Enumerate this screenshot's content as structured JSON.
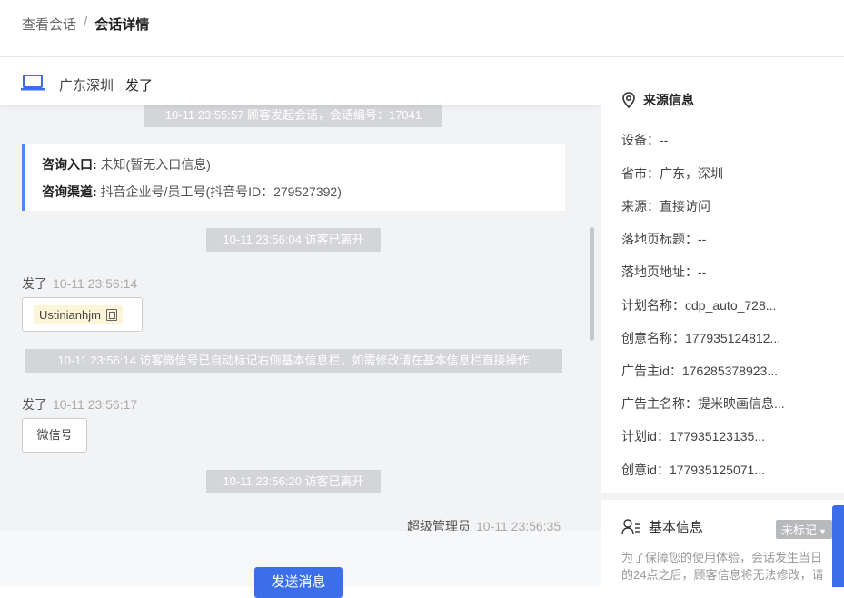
{
  "breadcrumb": {
    "parent": "查看会话",
    "separator": "/",
    "current": "会话详情"
  },
  "chat_header": {
    "location": "广东深圳",
    "visitor_name": "发了"
  },
  "messages": {
    "sys_start": "10-11 23:55:57 顾客发起会话，会话编号：17041",
    "info_entry_label": "咨询入口:",
    "info_entry_value": "未知(暂无入口信息)",
    "info_channel_label": "咨询渠道:",
    "info_channel_value": "抖音企业号/员工号(抖音号ID：279527392)",
    "sys_leave1": "10-11 23:56:04 访客已离开",
    "msg1_sender": "发了",
    "msg1_time": "10-11 23:56:14",
    "msg1_text": "Ustinianhjm",
    "sys_wechat": "10-11 23:56:14 访客微信号已自动标记右侧基本信息栏，如需修改请在基本信息栏直接操作",
    "msg2_sender": "发了",
    "msg2_time": "10-11 23:56:17",
    "msg2_text": "微信号",
    "sys_leave2": "10-11 23:56:20 访客已离开",
    "admin_sender": "超级管理员",
    "admin_time": "10-11 23:56:35"
  },
  "footer": {
    "send_label": "发送消息"
  },
  "source_info": {
    "title": "来源信息",
    "items": [
      "设备：--",
      "省市：广东，深圳",
      "来源：直接访问",
      "落地页标题：--",
      "落地页地址：--",
      "计划名称：cdp_auto_728...",
      "创意名称：177935124812...",
      "广告主id：176285378923...",
      "广告主名称：提米映画信息...",
      "计划id：177935123135...",
      "创意id：177935125071..."
    ]
  },
  "basic_info": {
    "title": "基本信息",
    "badge": "未标记",
    "note": "为了保障您的使用体验，会话发生当日的24点之后，顾客信息将无法修改，请"
  },
  "colors": {
    "accent": "#3b6ee8",
    "info_border": "#4a8cf7",
    "system_bubble": "#d4d5d8"
  }
}
